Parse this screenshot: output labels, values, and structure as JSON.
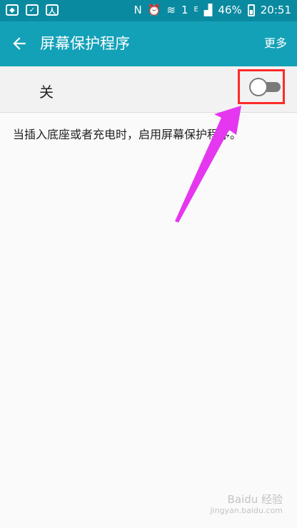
{
  "status_bar": {
    "battery_percent": "46%",
    "time": "20:51",
    "network_label": "E",
    "nfc_label": "N",
    "data_indicator": "1",
    "icons": [
      "cube-app-icon",
      "check-app-icon",
      "runner-icon",
      "nfc-icon",
      "alarm-icon",
      "wifi-icon",
      "signal-icon",
      "battery-icon"
    ]
  },
  "app_bar": {
    "title": "屏幕保护程序",
    "more_label": "更多",
    "background_color": "#13a1b8"
  },
  "toggle": {
    "label": "关",
    "state": "off"
  },
  "description": "当插入底座或者充电时，启用屏幕保护程序。",
  "annotation": {
    "highlight_color": "#ff2a2a",
    "arrow_color": "#e536f0"
  },
  "watermark": {
    "text": "Baidu 经验",
    "subtext": "jingyan.baidu.com"
  }
}
